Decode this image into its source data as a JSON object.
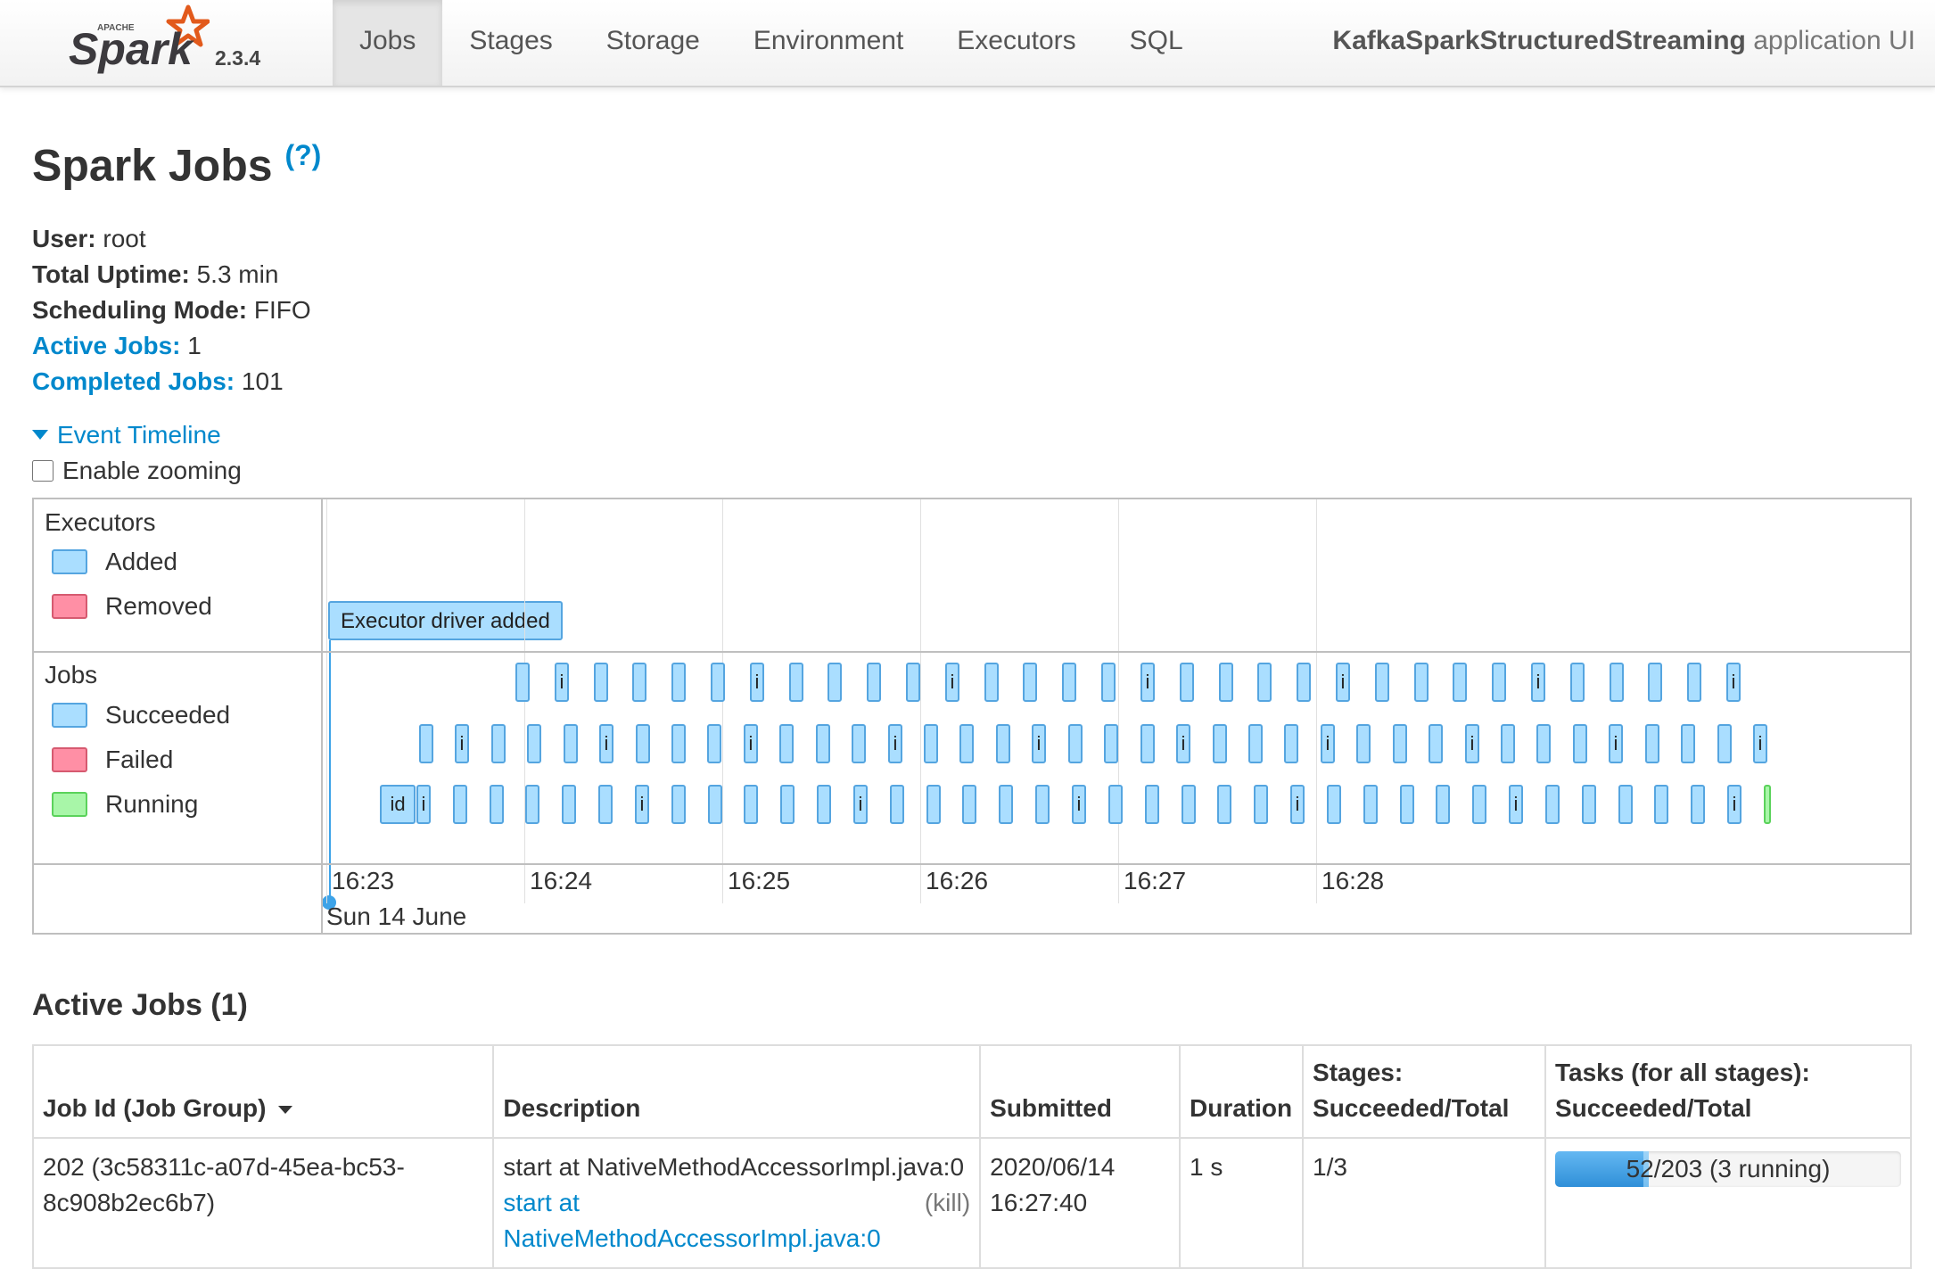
{
  "nav": {
    "version": "2.3.4",
    "tabs": [
      "Jobs",
      "Stages",
      "Storage",
      "Environment",
      "Executors",
      "SQL"
    ],
    "active_tab": "Jobs",
    "app_name": "KafkaSparkStructuredStreaming",
    "app_suffix": " application UI"
  },
  "page": {
    "title": "Spark Jobs",
    "help": "(?)"
  },
  "summary": {
    "user_label": "User:",
    "user": "root",
    "uptime_label": "Total Uptime:",
    "uptime": "5.3 min",
    "mode_label": "Scheduling Mode:",
    "mode": "FIFO",
    "active_label": "Active Jobs:",
    "active": "1",
    "completed_label": "Completed Jobs:",
    "completed": "101"
  },
  "timeline": {
    "toggle_label": "Event Timeline",
    "zoom_label": "Enable zooming",
    "executors_label": "Executors",
    "legend_added": "Added",
    "legend_removed": "Removed",
    "jobs_label": "Jobs",
    "legend_succeeded": "Succeeded",
    "legend_failed": "Failed",
    "legend_running": "Running",
    "executor_event": "Executor driver added",
    "axis_times": [
      "16:23",
      "16:24",
      "16:25",
      "16:26",
      "16:27",
      "16:28"
    ],
    "date": "Sun 14 June",
    "job_rows": {
      "top_count": 32,
      "middle_count": 38,
      "bottom_count": 39
    },
    "first_job_label": "id",
    "truncated_label": "i",
    "colors": {
      "succeeded": "#aadeff",
      "failed": "#ff8fa5",
      "running": "#a8f6a8",
      "executor_line": "#3da3e8"
    }
  },
  "active_jobs": {
    "title": "Active Jobs (1)",
    "headers": {
      "job_id": "Job Id (Job Group)",
      "description": "Description",
      "submitted": "Submitted",
      "duration": "Duration",
      "stages_1": "Stages:",
      "stages_2": "Succeeded/Total",
      "tasks_1": "Tasks (for all stages):",
      "tasks_2": "Succeeded/Total"
    },
    "rows": [
      {
        "job_id_1": "202 (3c58311c-a07d-45ea-bc53-",
        "job_id_2": "8c908b2ec6b7)",
        "description": "start at NativeMethodAccessorImpl.java:0",
        "link_1": "start at",
        "link_2": "NativeMethodAccessorImpl.java:0",
        "kill": "(kill)",
        "submitted_1": "2020/06/14",
        "submitted_2": "16:27:40",
        "duration": "1 s",
        "stages": "1/3",
        "tasks_text": "52/203 (3 running)",
        "tasks_succeeded": 52,
        "tasks_running": 3,
        "tasks_total": 203
      }
    ]
  }
}
